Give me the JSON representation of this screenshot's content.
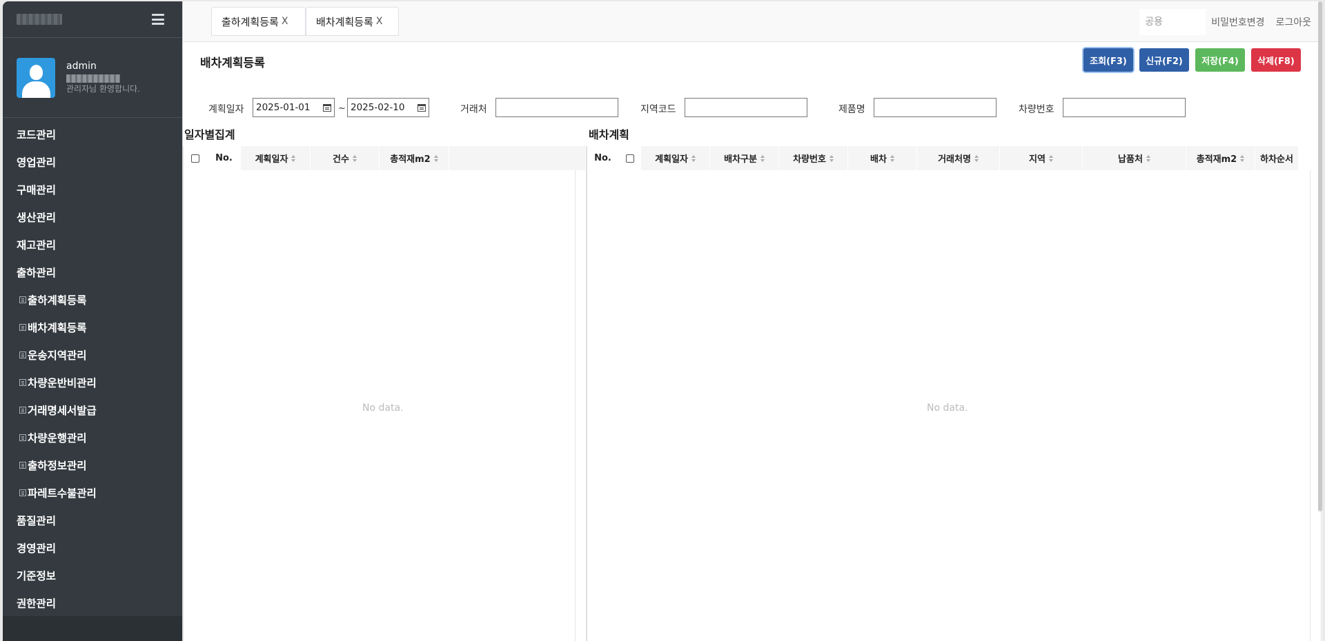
{
  "user": {
    "name": "admin",
    "welcome": "관리자님 환영합니다."
  },
  "sidebar": {
    "items": [
      {
        "label": "코드관리",
        "sub": false
      },
      {
        "label": "영업관리",
        "sub": false
      },
      {
        "label": "구매관리",
        "sub": false
      },
      {
        "label": "생산관리",
        "sub": false
      },
      {
        "label": "재고관리",
        "sub": false
      },
      {
        "label": "출하관리",
        "sub": false
      },
      {
        "label": "출하계획등록",
        "sub": true
      },
      {
        "label": "배차계획등록",
        "sub": true
      },
      {
        "label": "운송지역관리",
        "sub": true
      },
      {
        "label": "차량운반비관리",
        "sub": true
      },
      {
        "label": "거래명세서발급",
        "sub": true
      },
      {
        "label": "차량운행관리",
        "sub": true
      },
      {
        "label": "출하정보관리",
        "sub": true
      },
      {
        "label": "파레트수불관리",
        "sub": true
      },
      {
        "label": "품질관리",
        "sub": false
      },
      {
        "label": "경영관리",
        "sub": false
      },
      {
        "label": "기준정보",
        "sub": false
      },
      {
        "label": "권한관리",
        "sub": false
      }
    ]
  },
  "tabs": [
    {
      "label": "출하계획등록",
      "close": "X"
    },
    {
      "label": "배차계획등록",
      "close": "X"
    }
  ],
  "topbar": {
    "search_placeholder": "공용",
    "change_password": "비밀번호변경",
    "logout": "로그아웃"
  },
  "page": {
    "title": "배차계획등록"
  },
  "buttons": {
    "search": "조회(F3)",
    "new": "신규(F2)",
    "save": "저장(F4)",
    "delete": "삭제(F8)"
  },
  "filters": {
    "plan_date_label": "계획일자",
    "date_from": "2025-01-01",
    "date_sep": "~",
    "date_to": "2025-02-10",
    "customer_label": "거래처",
    "customer_value": "",
    "region_label": "지역코드",
    "region_value": "",
    "product_label": "제품명",
    "product_value": "",
    "vehicle_label": "차량번호",
    "vehicle_value": ""
  },
  "left_grid": {
    "title": "일자별집계",
    "columns": [
      "No.",
      "계획일자",
      "건수",
      "총적재m2"
    ],
    "empty": "No data."
  },
  "right_grid": {
    "title": "배차계획",
    "columns": [
      "No.",
      "계획일자",
      "배차구분",
      "차량번호",
      "배차",
      "거래처명",
      "지역",
      "납품처",
      "총적재m2",
      "하차순서"
    ],
    "empty": "No data."
  },
  "colors": {
    "sidebar_bg": "#343a40",
    "primary": "#2f5fa7",
    "success": "#5cb85c",
    "danger": "#dc3545",
    "avatar": "#2f99df"
  }
}
